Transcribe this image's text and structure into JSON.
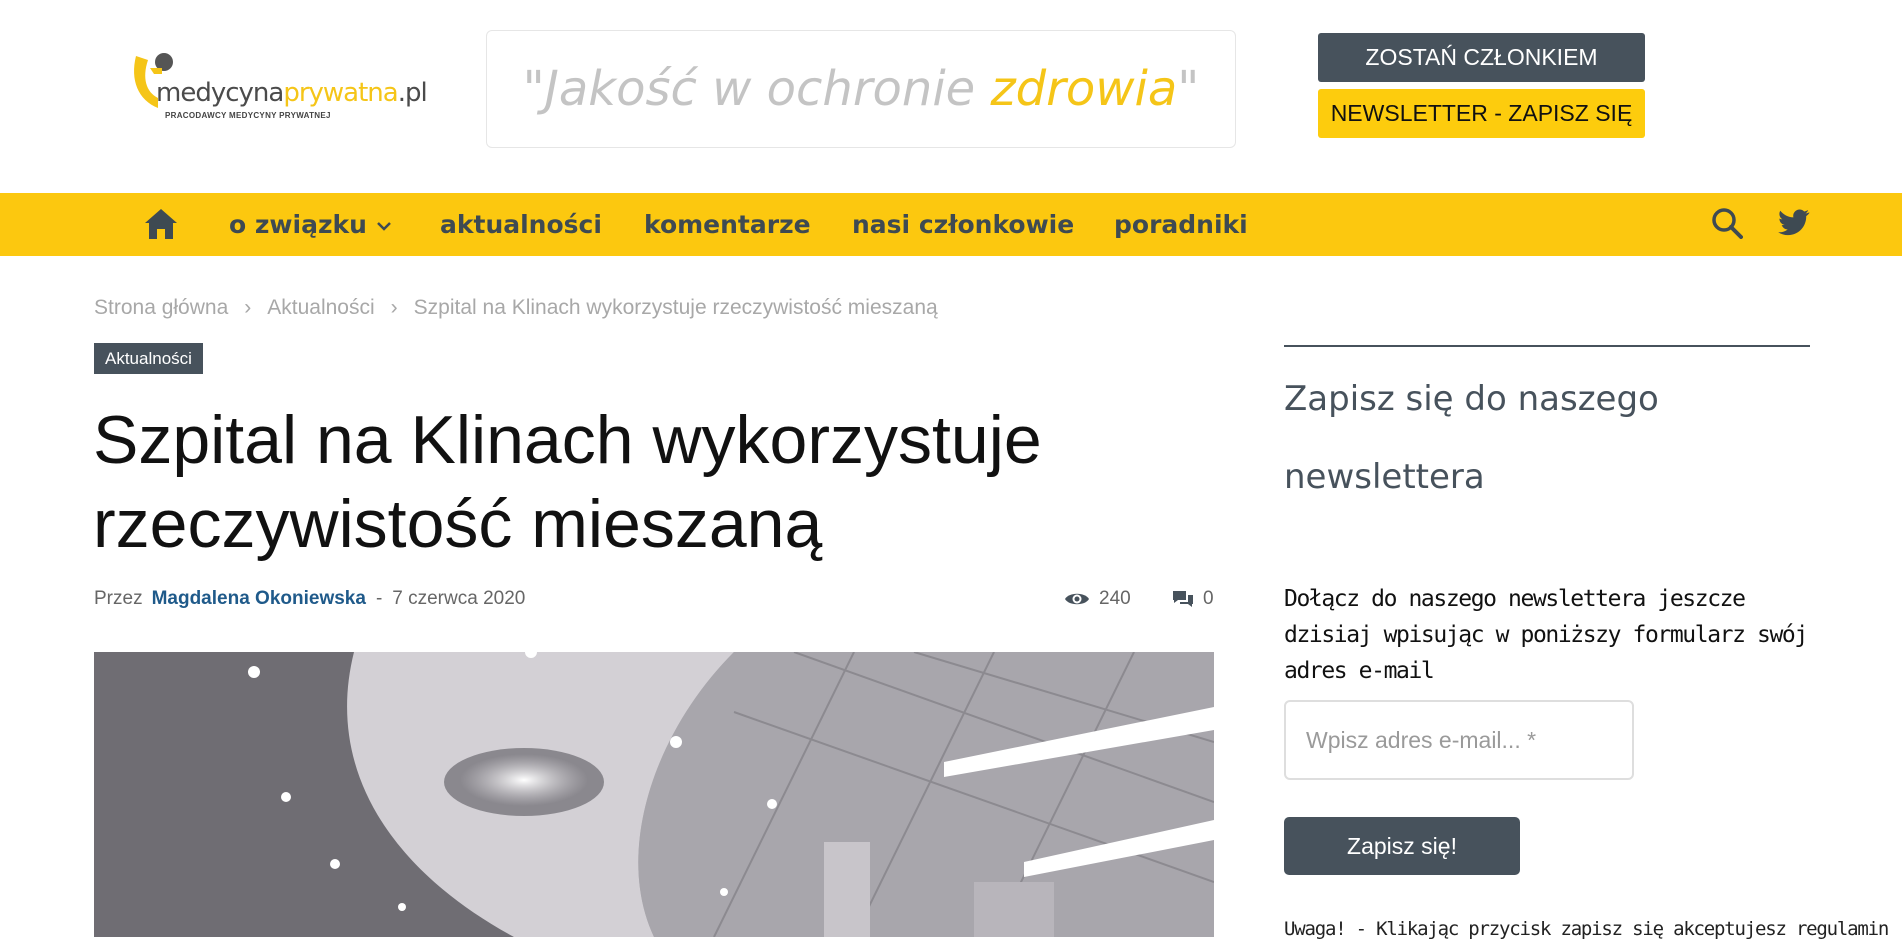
{
  "header": {
    "logo": {
      "text_part1": "medycyna",
      "text_part2": "prywatna",
      "text_part3": ".pl",
      "subtitle": "PRACODAWCY MEDYCYNY PRYWATNEJ"
    },
    "slogan": {
      "open_quote": "\"",
      "text": "Jakość w ochronie ",
      "highlight": "zdrowia",
      "close_quote": "\""
    },
    "member_button": "ZOSTAŃ CZŁONKIEM",
    "newsletter_button": "NEWSLETTER - ZAPISZ SIĘ",
    "colors": {
      "brand_yellow": "#fcc80f",
      "dark_slate": "#47525c"
    }
  },
  "nav": {
    "home_icon": "home-icon",
    "items": [
      {
        "label": "o związku",
        "has_dropdown": true
      },
      {
        "label": "aktualności"
      },
      {
        "label": "komentarze"
      },
      {
        "label": "nasi członkowie"
      },
      {
        "label": "poradniki"
      }
    ],
    "search_icon": "search-icon",
    "twitter_icon": "twitter-icon"
  },
  "breadcrumb": {
    "items": [
      "Strona główna",
      "Aktualności",
      "Szpital na Klinach wykorzystuje rzeczywistość mieszaną"
    ],
    "separator": "›"
  },
  "article": {
    "category": "Aktualności",
    "title": "Szpital na Klinach wykorzystuje rzeczywistość mieszaną",
    "by_label": "Przez",
    "author": "Magdalena Okoniewska",
    "dash": "-",
    "date": "7 czerwca 2020",
    "views": "240",
    "comments": "0"
  },
  "sidebar": {
    "heading": "Zapisz się do naszego newslettera",
    "description": "Dołącz do naszego newslettera jeszcze dzisiaj wpisując w poniższy formularz swój adres e-mail",
    "email_placeholder": "Wpisz adres e-mail... *",
    "submit_label": "Zapisz się!",
    "note": "Uwaga! - Klikając przycisk zapisz się akceptujesz regulamin"
  }
}
